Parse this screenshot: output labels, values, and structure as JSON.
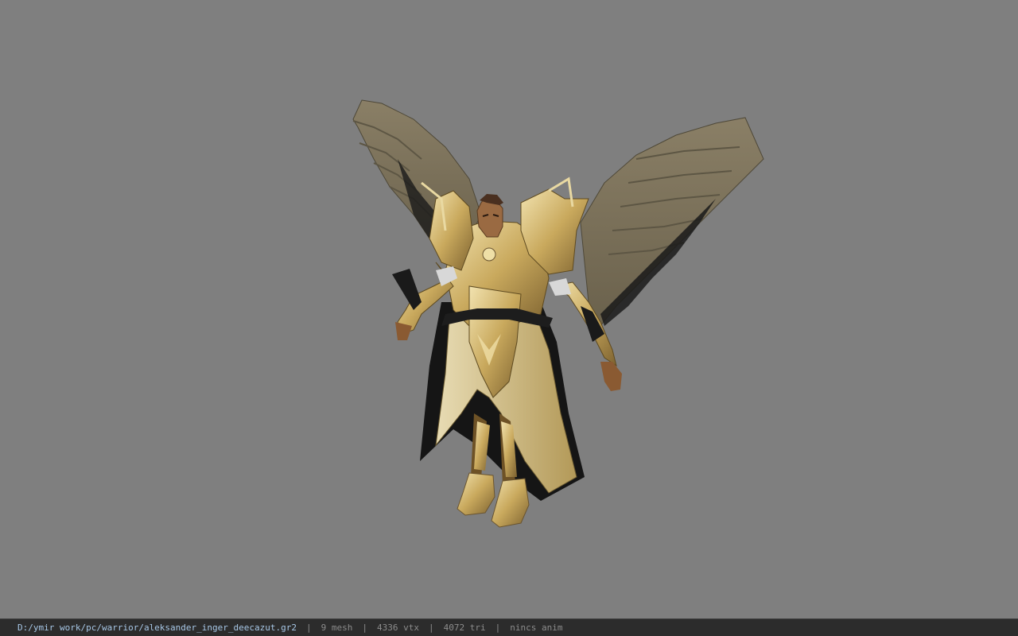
{
  "viewport": {
    "background_color": "#7f7f7f",
    "model_name": "winged-armored-warrior"
  },
  "status_bar": {
    "file_path": "D:/ymir work/pc/warrior/aleksander_inger_deecazut.gr2",
    "separator": "|",
    "mesh_count": "9 mesh",
    "vertex_count": "4336 vtx",
    "triangle_count": "4072 tri",
    "animation_status": "nincs anim",
    "path_color": "#a7c7e6",
    "text_color": "#8c8c8c"
  }
}
